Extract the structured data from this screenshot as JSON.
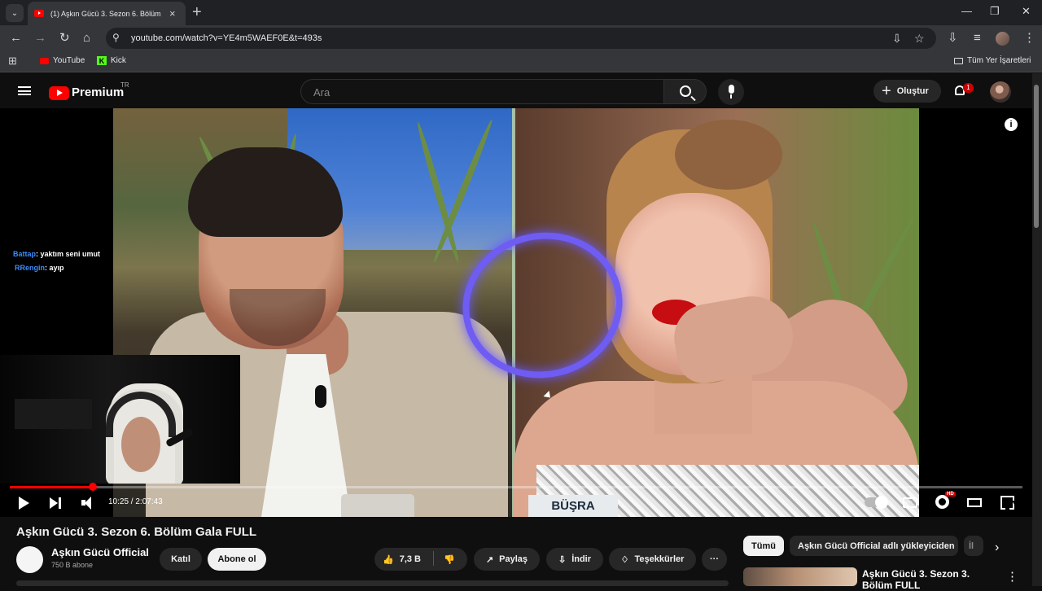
{
  "browser": {
    "tab_title": "(1) Aşkın Gücü 3. Sezon 6. Bölüm",
    "url": "youtube.com/watch?v=YE4m5WAEF0E&t=493s",
    "bookmarks": [
      "YouTube",
      "Kick"
    ],
    "bookmarks_right": "Tüm Yer İşaretleri"
  },
  "youtube": {
    "brand": "Premium",
    "region": "TR",
    "search_placeholder": "Ara",
    "create_label": "Oluştur",
    "notifications": "1"
  },
  "video": {
    "overlay_chat": [
      {
        "user": "Battap",
        "message": ": yaktım seni umut"
      },
      {
        "user": "RRengin",
        "message": ": ayıp"
      }
    ],
    "name_card": "BÜŞRA",
    "time": "10:25 / 2:07:43",
    "progress": 0.0818,
    "hd_badge": "HD",
    "info_icon": "i"
  },
  "details": {
    "title": "Aşkın Gücü 3. Sezon 6. Bölüm Gala FULL",
    "channel": "Aşkın Gücü Official",
    "subscribers": "750 B abone",
    "join": "Katıl",
    "subscribe": "Abone ol",
    "likes": "7,3 B",
    "share": "Paylaş",
    "download": "İndir",
    "thanks": "Teşekkürler",
    "more": "···"
  },
  "recommendations": {
    "chips": [
      "Tümü",
      "Aşkın Gücü Official adlı yükleyiciden",
      "İl"
    ],
    "first_title": "Aşkın Gücü 3. Sezon 3. Bölüm FULL"
  },
  "icons": {
    "tab": "youtube-favicon",
    "search": "search-icon",
    "mic": "mic-icon",
    "bell": "bell-icon",
    "play": "play-icon",
    "next": "next-icon",
    "volume": "volume-icon",
    "settings": "gear-icon",
    "fullscreen": "fullscreen-icon"
  },
  "colors": {
    "youtube_red": "#ff0000",
    "background": "#0f0f0f",
    "progress": "#ff0000"
  }
}
